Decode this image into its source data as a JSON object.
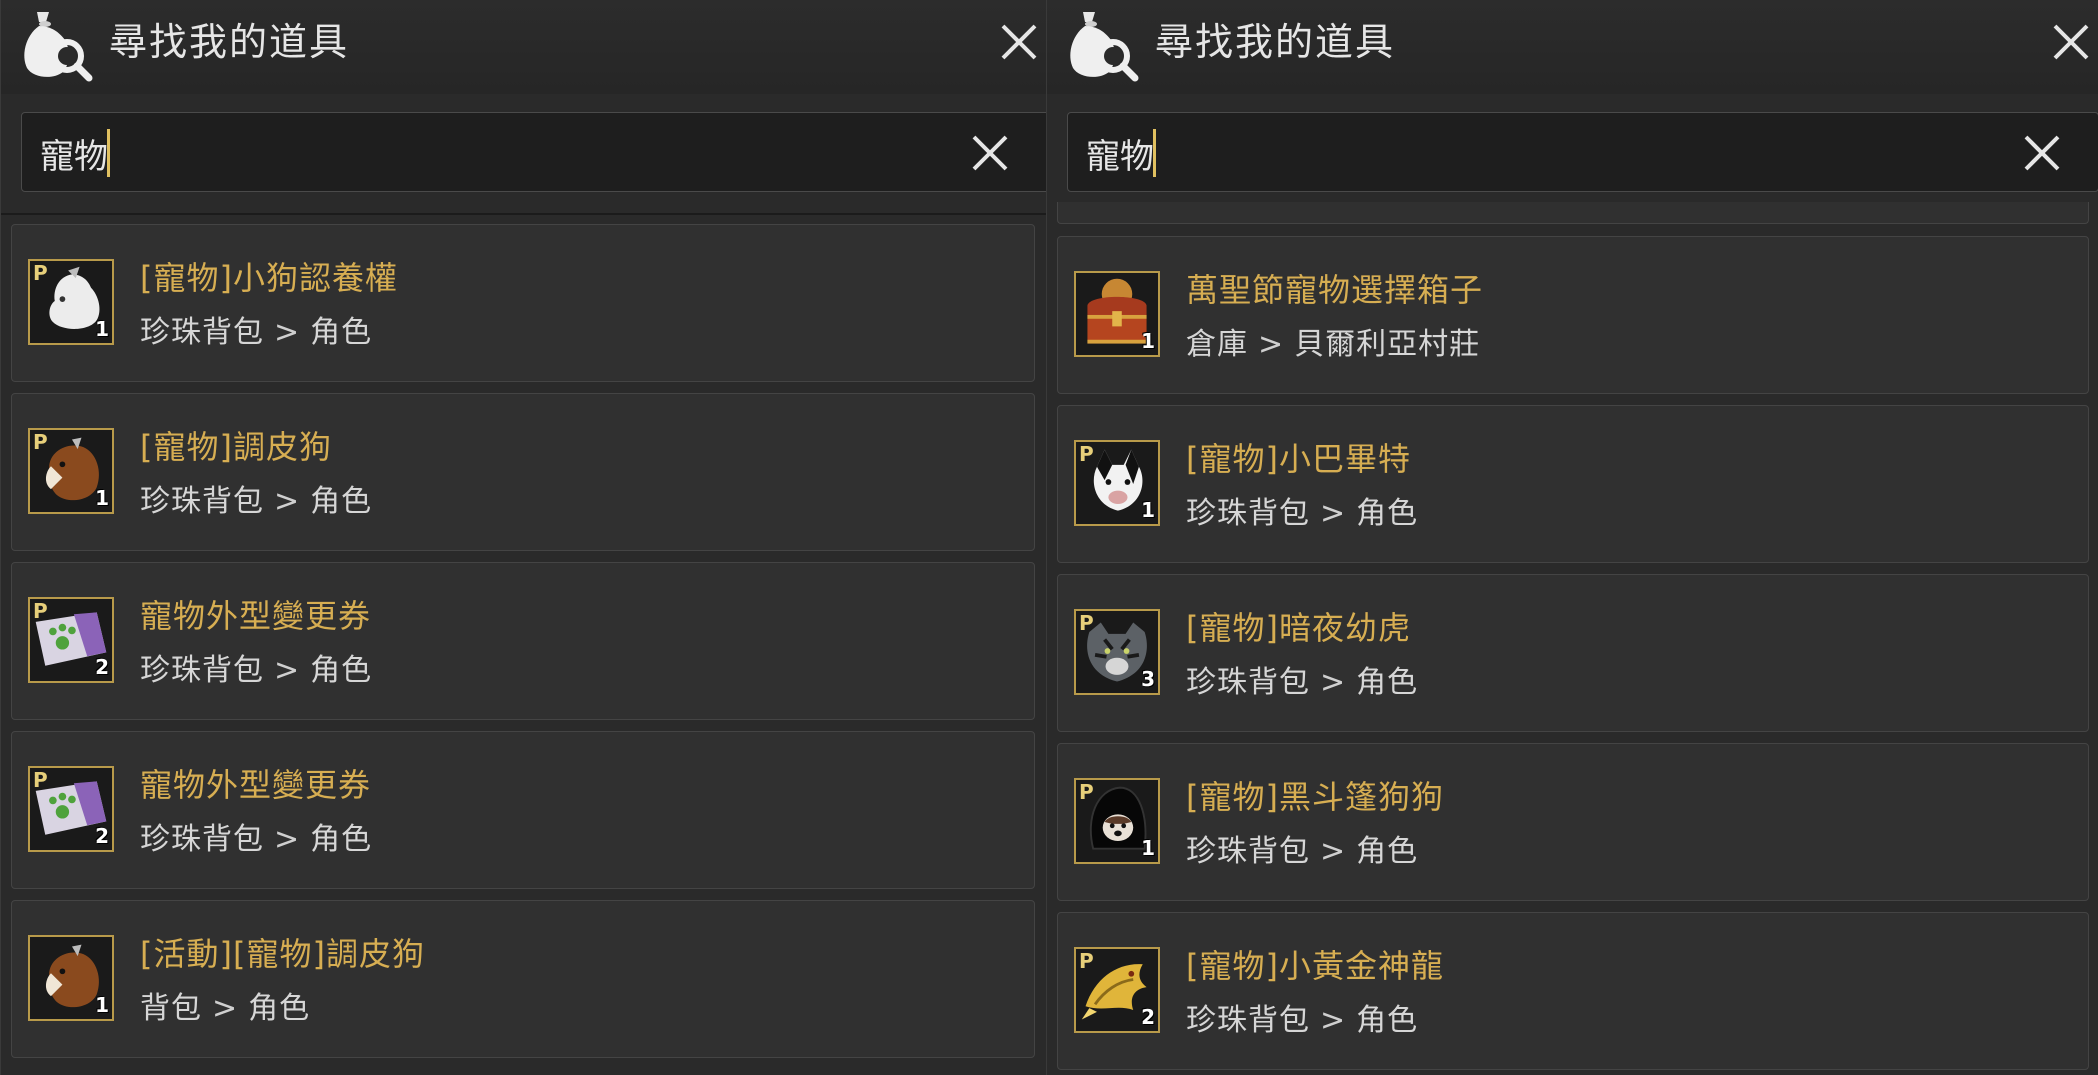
{
  "panels": [
    {
      "title": "尋找我的道具",
      "search_value": "寵物",
      "results": [
        {
          "name": "[寵物]小狗認養權",
          "location_from": "珍珠背包",
          "location_to": "角色",
          "badge": "P",
          "qty": "1",
          "icon": "white-dog-icon"
        },
        {
          "name": "[寵物]調皮狗",
          "location_from": "珍珠背包",
          "location_to": "角色",
          "badge": "P",
          "qty": "1",
          "icon": "brown-dog-icon"
        },
        {
          "name": "寵物外型變更券",
          "location_from": "珍珠背包",
          "location_to": "角色",
          "badge": "P",
          "qty": "2",
          "icon": "paw-coupon-icon"
        },
        {
          "name": "寵物外型變更券",
          "location_from": "珍珠背包",
          "location_to": "角色",
          "badge": "P",
          "qty": "2",
          "icon": "paw-coupon-icon"
        },
        {
          "name": "[活動][寵物]調皮狗",
          "location_from": "背包",
          "location_to": "角色",
          "badge": "",
          "qty": "1",
          "icon": "brown-dog-icon"
        }
      ]
    },
    {
      "title": "尋找我的道具",
      "search_value": "寵物",
      "results": [
        {
          "name": "萬聖節寵物選擇箱子",
          "location_from": "倉庫",
          "location_to": "貝爾利亞村莊",
          "badge": "",
          "qty": "1",
          "icon": "treasure-chest-icon"
        },
        {
          "name": "[寵物]小巴畢特",
          "location_from": "珍珠背包",
          "location_to": "角色",
          "badge": "P",
          "qty": "1",
          "icon": "cow-cat-icon"
        },
        {
          "name": "[寵物]暗夜幼虎",
          "location_from": "珍珠背包",
          "location_to": "角色",
          "badge": "P",
          "qty": "3",
          "icon": "tiger-icon"
        },
        {
          "name": "[寵物]黑斗篷狗狗",
          "location_from": "珍珠背包",
          "location_to": "角色",
          "badge": "P",
          "qty": "1",
          "icon": "hooded-dog-icon"
        },
        {
          "name": "[寵物]小黃金神龍",
          "location_from": "珍珠背包",
          "location_to": "角色",
          "badge": "P",
          "qty": "2",
          "icon": "golden-dragon-icon"
        }
      ]
    }
  ],
  "colors": {
    "item_name": "#d7ae52",
    "slot_border": "#b89a4a",
    "panel_bg": "#2a2a2a",
    "card_bg": "#303030"
  }
}
